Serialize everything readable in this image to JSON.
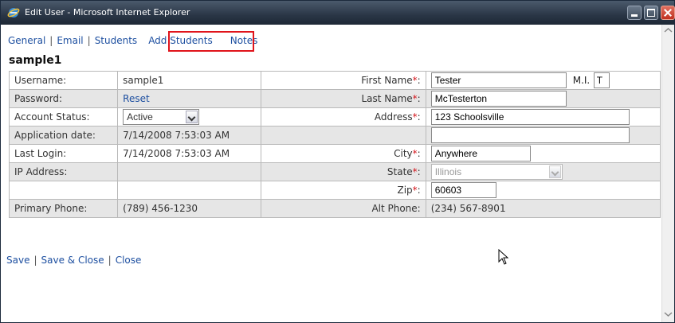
{
  "window": {
    "title": "Edit User - Microsoft Internet Explorer"
  },
  "tabs": [
    {
      "label": "General"
    },
    {
      "label": "Email"
    },
    {
      "label": "Students"
    },
    {
      "label": "Add Students"
    },
    {
      "label": "Notes"
    }
  ],
  "heading": "sample1",
  "left": {
    "username": {
      "label": "Username:",
      "value": "sample1"
    },
    "password": {
      "label": "Password:",
      "link": "Reset"
    },
    "account_status": {
      "label": "Account Status:",
      "value": "Active"
    },
    "application_date": {
      "label": "Application date:",
      "value": "7/14/2008 7:53:03 AM"
    },
    "last_login": {
      "label": "Last Login:",
      "value": "7/14/2008 7:53:03 AM"
    },
    "ip_address": {
      "label": "IP Address:",
      "value": ""
    },
    "primary_phone": {
      "label": "Primary Phone:",
      "value": "(789) 456-1230"
    }
  },
  "right": {
    "required_mark": "*",
    "first_name": {
      "label": "First Name",
      "value": "Tester"
    },
    "mi": {
      "label": "M.I.",
      "value": "T"
    },
    "last_name": {
      "label": "Last Name",
      "value": "McTesterton"
    },
    "address": {
      "label": "Address",
      "value": "123 Schoolsville"
    },
    "address2": {
      "value": ""
    },
    "city": {
      "label": "City",
      "value": "Anywhere"
    },
    "state": {
      "label": "State",
      "value": "Illinois"
    },
    "zip": {
      "label": "Zip",
      "value": "60603"
    },
    "alt_phone": {
      "label": "Alt Phone:",
      "value": "(234) 567-8901"
    }
  },
  "actions": [
    {
      "label": "Save"
    },
    {
      "label": "Save & Close"
    },
    {
      "label": "Close"
    }
  ],
  "colors": {
    "link": "#1d4fa0",
    "required": "#d4141b",
    "highlight_box": "#e0141b",
    "alt_row": "#e6e6e6"
  }
}
